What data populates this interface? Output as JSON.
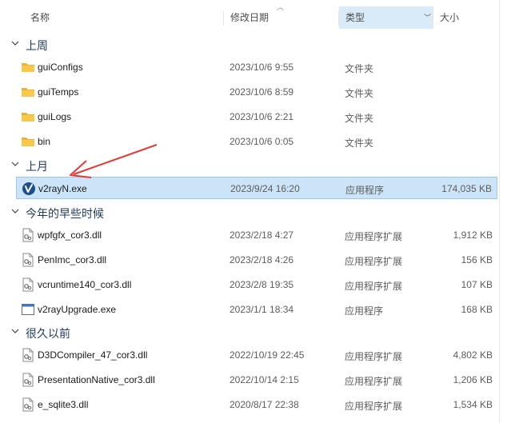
{
  "columns": {
    "name": "名称",
    "date": "修改日期",
    "type": "类型",
    "size": "大小"
  },
  "groups": [
    {
      "label": "上周",
      "items": [
        {
          "name": "guiConfigs",
          "date": "2023/10/6 9:55",
          "type": "文件夹",
          "size": "",
          "icon": "folder-icon"
        },
        {
          "name": "guiTemps",
          "date": "2023/10/6 8:59",
          "type": "文件夹",
          "size": "",
          "icon": "folder-icon"
        },
        {
          "name": "guiLogs",
          "date": "2023/10/6 2:21",
          "type": "文件夹",
          "size": "",
          "icon": "folder-icon"
        },
        {
          "name": "bin",
          "date": "2023/10/6 0:05",
          "type": "文件夹",
          "size": "",
          "icon": "folder-icon"
        }
      ]
    },
    {
      "label": "上月",
      "items": [
        {
          "name": "v2rayN.exe",
          "date": "2023/9/24 16:20",
          "type": "应用程序",
          "size": "174,035 KB",
          "icon": "v2rayn-app-icon",
          "selected": true
        }
      ]
    },
    {
      "label": "今年的早些时候",
      "items": [
        {
          "name": "wpfgfx_cor3.dll",
          "date": "2023/2/18 4:27",
          "type": "应用程序扩展",
          "size": "1,912 KB",
          "icon": "dll-file-icon"
        },
        {
          "name": "PenImc_cor3.dll",
          "date": "2023/2/18 4:26",
          "type": "应用程序扩展",
          "size": "156 KB",
          "icon": "dll-file-icon"
        },
        {
          "name": "vcruntime140_cor3.dll",
          "date": "2023/2/8 19:35",
          "type": "应用程序扩展",
          "size": "107 KB",
          "icon": "dll-file-icon"
        },
        {
          "name": "v2rayUpgrade.exe",
          "date": "2023/1/1 18:34",
          "type": "应用程序",
          "size": "168 KB",
          "icon": "exe-file-icon"
        }
      ]
    },
    {
      "label": "很久以前",
      "items": [
        {
          "name": "D3DCompiler_47_cor3.dll",
          "date": "2022/10/19 22:45",
          "type": "应用程序扩展",
          "size": "4,802 KB",
          "icon": "dll-file-icon"
        },
        {
          "name": "PresentationNative_cor3.dll",
          "date": "2022/10/14 2:15",
          "type": "应用程序扩展",
          "size": "1,206 KB",
          "icon": "dll-file-icon"
        },
        {
          "name": "e_sqlite3.dll",
          "date": "2020/8/17 22:38",
          "type": "应用程序扩展",
          "size": "1,534 KB",
          "icon": "dll-file-icon"
        }
      ]
    }
  ],
  "colors": {
    "selection_bg": "#cce4f7",
    "annotation_arrow": "#e53935",
    "folder_yellow": "#f8c948"
  }
}
